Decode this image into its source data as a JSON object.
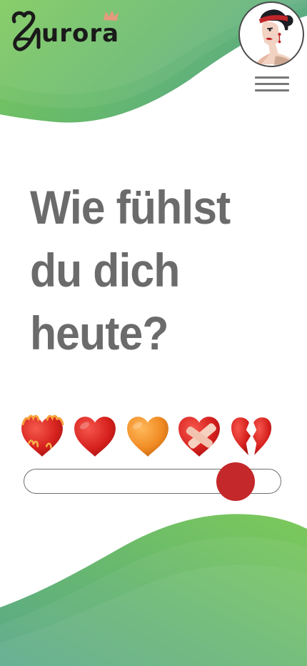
{
  "app": {
    "logo_text": "Aurora",
    "logo_icon": "crown-icon"
  },
  "header": {
    "avatar_icon": "woman-profile-icon",
    "menu_icon": "hamburger-menu-icon"
  },
  "question": {
    "line1": "Wie fühlst",
    "line2": "du dich",
    "line3": "heute?"
  },
  "mood": {
    "options": [
      {
        "icon": "heart-on-fire-icon",
        "meaning": "on fire"
      },
      {
        "icon": "red-heart-icon",
        "meaning": "love"
      },
      {
        "icon": "orange-heart-icon",
        "meaning": "warm"
      },
      {
        "icon": "mending-heart-icon",
        "meaning": "healing"
      },
      {
        "icon": "broken-heart-icon",
        "meaning": "heartbroken"
      }
    ],
    "slider_value": 0.88
  },
  "colors": {
    "wave_green": "#6cc35a",
    "wave_teal": "#5aa88a",
    "text_gray": "#6b6b6b",
    "thumb_red": "#c4282a",
    "logo_black": "#1a1a1a",
    "crown_salmon": "#e59a7c"
  }
}
